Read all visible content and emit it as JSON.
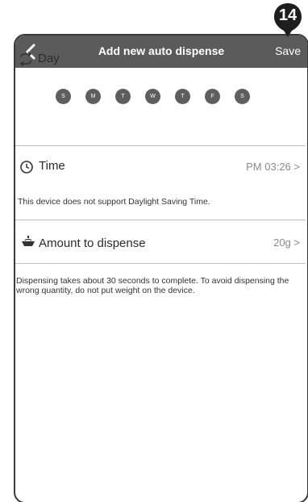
{
  "badge": {
    "number": "14"
  },
  "header": {
    "title": "Add new auto dispense",
    "save_label": "Save"
  },
  "day": {
    "label": "Day",
    "days": [
      "S",
      "M",
      "T",
      "W",
      "T",
      "F",
      "S"
    ]
  },
  "time": {
    "label": "Time",
    "value": "PM 03:26 >"
  },
  "dst_note": "This device does not support Daylight Saving Time.",
  "amount": {
    "label": "Amount to dispense",
    "value": "20g >"
  },
  "info_note": "Dispensing takes about 30 seconds to complete. To avoid dispensing the wrong quantity, do not put weight on the device.",
  "colors": {
    "header_bg": "#5b5b5b",
    "day_dot": "#5e5e5e",
    "value_text": "#8a8a8a"
  },
  "icons": [
    "back-chevron-icon",
    "repeat-icon",
    "clock-icon",
    "bowl-icon",
    "step-badge"
  ]
}
